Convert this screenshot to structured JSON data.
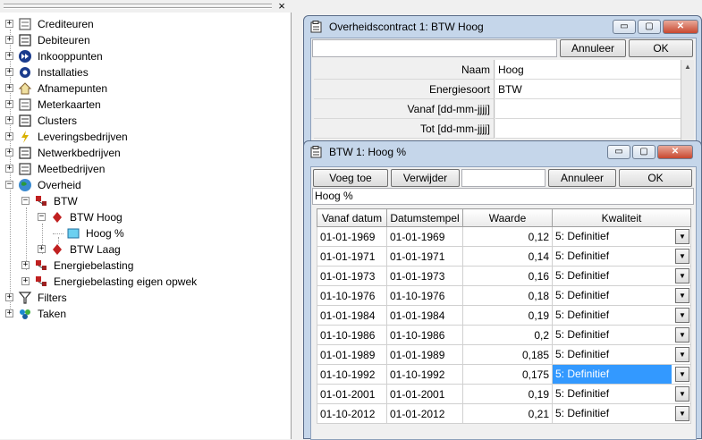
{
  "tree": {
    "close_label": "×",
    "items": [
      {
        "label": "Crediteuren",
        "icon": "ledger-icon",
        "expander": "+"
      },
      {
        "label": "Debiteuren",
        "icon": "people-icon",
        "expander": "+"
      },
      {
        "label": "Inkooppunten",
        "icon": "fast-forward-icon",
        "expander": "+"
      },
      {
        "label": "Installaties",
        "icon": "gear-icon",
        "expander": "+"
      },
      {
        "label": "Afnamepunten",
        "icon": "house-icon",
        "expander": "+"
      },
      {
        "label": "Meterkaarten",
        "icon": "meter-card-icon",
        "expander": "+"
      },
      {
        "label": "Clusters",
        "icon": "cluster-icon",
        "expander": "+"
      },
      {
        "label": "Leveringsbedrijven",
        "icon": "lightning-icon",
        "expander": "+"
      },
      {
        "label": "Netwerkbedrijven",
        "icon": "pylon-icon",
        "expander": "+"
      },
      {
        "label": "Meetbedrijven",
        "icon": "meter-icon",
        "expander": "+"
      },
      {
        "label": "Overheid",
        "icon": "globe-icon",
        "expander": "−"
      },
      {
        "label": "BTW",
        "icon": "contract-icon",
        "expander": "−"
      },
      {
        "label": "BTW Hoog",
        "icon": "diamond-icon",
        "expander": "−"
      },
      {
        "label": "Hoog %",
        "icon": "table-icon",
        "expander": ""
      },
      {
        "label": "BTW Laag",
        "icon": "diamond-icon",
        "expander": "+"
      },
      {
        "label": "Energiebelasting",
        "icon": "contract-icon",
        "expander": "+"
      },
      {
        "label": "Energiebelasting eigen opwek",
        "icon": "contract-icon",
        "expander": "+"
      },
      {
        "label": "Filters",
        "icon": "filter-icon",
        "expander": "+"
      },
      {
        "label": "Taken",
        "icon": "tasks-icon",
        "expander": "+"
      }
    ]
  },
  "contract_window": {
    "title": "Overheidscontract 1: BTW Hoog",
    "buttons": {
      "minimize": "▭",
      "maximize": "▢",
      "close": "✕"
    },
    "cancel_label": "Annuleer",
    "ok_label": "OK",
    "properties": [
      {
        "label": "Naam",
        "value": "Hoog"
      },
      {
        "label": "Energiesoort",
        "value": "BTW"
      },
      {
        "label": "Vanaf [dd-mm-jjjj]",
        "value": ""
      },
      {
        "label": "Tot [dd-mm-jjjj]",
        "value": ""
      }
    ]
  },
  "btw_window": {
    "title": "BTW 1: Hoog %",
    "buttons": {
      "minimize": "▭",
      "maximize": "▢",
      "close": "✕"
    },
    "add_label": "Voeg toe",
    "remove_label": "Verwijder",
    "cancel_label": "Annuleer",
    "ok_label": "OK",
    "name_value": "Hoog %",
    "columns": [
      "Vanaf datum",
      "Datumstempel",
      "Waarde",
      "Kwaliteit"
    ],
    "rows": [
      {
        "vanaf": "01-01-1969",
        "stempel": "01-01-1969",
        "waarde": "0,12",
        "kwaliteit": "5: Definitief"
      },
      {
        "vanaf": "01-01-1971",
        "stempel": "01-01-1971",
        "waarde": "0,14",
        "kwaliteit": "5: Definitief"
      },
      {
        "vanaf": "01-01-1973",
        "stempel": "01-01-1973",
        "waarde": "0,16",
        "kwaliteit": "5: Definitief"
      },
      {
        "vanaf": "01-10-1976",
        "stempel": "01-10-1976",
        "waarde": "0,18",
        "kwaliteit": "5: Definitief"
      },
      {
        "vanaf": "01-01-1984",
        "stempel": "01-01-1984",
        "waarde": "0,19",
        "kwaliteit": "5: Definitief"
      },
      {
        "vanaf": "01-10-1986",
        "stempel": "01-10-1986",
        "waarde": "0,2",
        "kwaliteit": "5: Definitief"
      },
      {
        "vanaf": "01-01-1989",
        "stempel": "01-01-1989",
        "waarde": "0,185",
        "kwaliteit": "5: Definitief"
      },
      {
        "vanaf": "01-10-1992",
        "stempel": "01-10-1992",
        "waarde": "0,175",
        "kwaliteit": "5: Definitief",
        "selected": true
      },
      {
        "vanaf": "01-01-2001",
        "stempel": "01-01-2001",
        "waarde": "0,19",
        "kwaliteit": "5: Definitief"
      },
      {
        "vanaf": "01-10-2012",
        "stempel": "01-01-2012",
        "waarde": "0,21",
        "kwaliteit": "5: Definitief"
      }
    ]
  },
  "colors": {
    "selection": "#3399ff",
    "title_bar": "#c5d6ea"
  }
}
